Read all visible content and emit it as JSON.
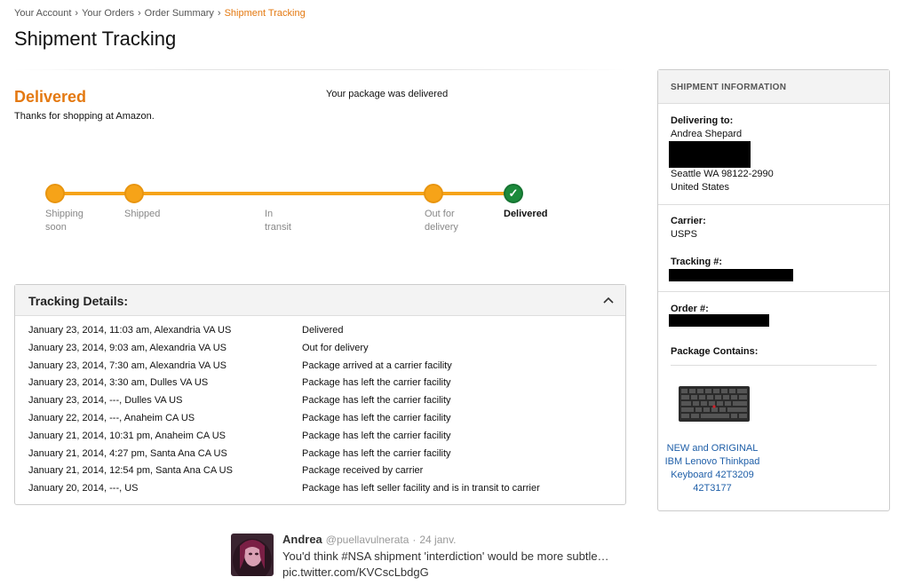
{
  "breadcrumb": {
    "items": [
      "Your Account",
      "Your Orders",
      "Order Summary"
    ],
    "current": "Shipment Tracking",
    "separator": "›"
  },
  "page_title": "Shipment Tracking",
  "status": {
    "word": "Delivered",
    "thanks": "Thanks for shopping at Amazon.",
    "message": "Your package was delivered",
    "accent_color": "#e47911"
  },
  "progress": {
    "steps": [
      "Shipping soon",
      "Shipped",
      "In transit",
      "Out for delivery",
      "Delivered"
    ],
    "current_step": "Delivered",
    "done_icon": "checkmark-icon"
  },
  "tracking_details": {
    "title": "Tracking Details:",
    "collapse_icon": "chevron-up-icon",
    "rows": [
      {
        "when": "January 23, 2014, 11:03 am, Alexandria VA US",
        "what": "Delivered"
      },
      {
        "when": "January 23, 2014, 9:03 am, Alexandria VA US",
        "what": "Out for delivery"
      },
      {
        "when": "January 23, 2014, 7:30 am, Alexandria VA US",
        "what": "Package arrived at a carrier facility"
      },
      {
        "when": "January 23, 2014, 3:30 am, Dulles VA US",
        "what": "Package has left the carrier facility"
      },
      {
        "when": "January 23, 2014, ---, Dulles VA US",
        "what": "Package has left the carrier facility"
      },
      {
        "when": "January 22, 2014, ---, Anaheim CA US",
        "what": "Package has left the carrier facility"
      },
      {
        "when": "January 21, 2014, 10:31 pm, Anaheim CA US",
        "what": "Package has left the carrier facility"
      },
      {
        "when": "January 21, 2014, 4:27 pm, Santa Ana CA US",
        "what": "Package has left the carrier facility"
      },
      {
        "when": "January 21, 2014, 12:54 pm, Santa Ana CA US",
        "what": "Package received by carrier"
      },
      {
        "when": "January 20, 2014, ---, US",
        "what": "Package has left seller facility and is in transit to carrier"
      }
    ]
  },
  "shipment_info": {
    "title": "SHIPMENT INFORMATION",
    "delivering_label": "Delivering to:",
    "recipient": "Andrea Shepard",
    "city_line": "Seattle WA 98122-2990",
    "country": "United States",
    "carrier_label": "Carrier:",
    "carrier": "USPS",
    "tracking_label": "Tracking #:",
    "order_label": "Order #:",
    "package_label": "Package Contains:",
    "item_link": "NEW and ORIGINAL IBM Lenovo Thinkpad Keyboard 42T3209 42T3177"
  },
  "tweet": {
    "name": "Andrea",
    "handle": "@puellavulnerata",
    "separator": "·",
    "time": "24 janv.",
    "line1": "You'd think #NSA shipment 'interdiction' would be more subtle…",
    "line2": "pic.twitter.com/KVCscLbdgG"
  }
}
